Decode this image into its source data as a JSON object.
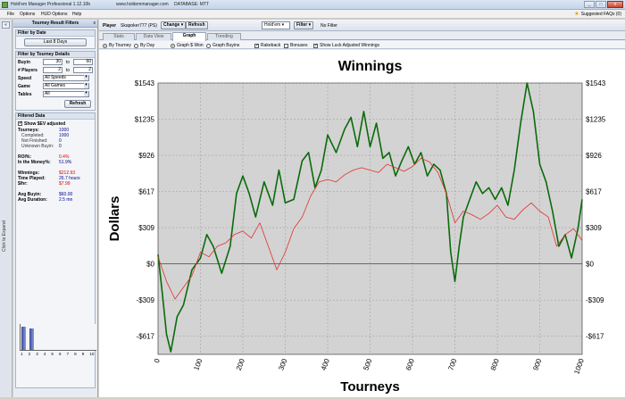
{
  "window": {
    "title": "Hold'em Manager Professional 1.12.10b",
    "url": "www.holdemmanager.com",
    "database": "DATABASE: MTT",
    "buttons": [
      "_",
      "□",
      "x"
    ]
  },
  "menu": {
    "items": [
      "File",
      "Options",
      "HUD Options",
      "Help"
    ],
    "suggested": "Suggested FAQs (0)"
  },
  "leftstrip": {
    "pin": "«",
    "label": "Click to Expand"
  },
  "filters": {
    "header": "Tourney Result Filters",
    "close": "x",
    "by_date": {
      "title": "Filter by Date",
      "button": "Last 8 Days"
    },
    "details": {
      "title": "Filter by Tourney Details",
      "buyin": {
        "label": "Buyin",
        "from": "30",
        "to_label": "to",
        "to": "60"
      },
      "players": {
        "label": "# Players",
        "from": "2",
        "to_label": "to",
        "to": "2"
      },
      "speed": {
        "label": "Speed",
        "value": "All Speeds"
      },
      "game": {
        "label": "Game",
        "value": "All Games"
      },
      "tables": {
        "label": "Tables",
        "value": "All"
      },
      "refresh": "Refresh"
    },
    "filtered": {
      "title": "Filtered Data",
      "show_ev": "Show $EV adjusted",
      "stats": [
        {
          "k": "Tourneys:",
          "v": "1000",
          "sub": false,
          "red": false
        },
        {
          "k": "Completed:",
          "v": "1000",
          "sub": true,
          "red": false
        },
        {
          "k": "Not Finished:",
          "v": "0",
          "sub": true,
          "red": false
        },
        {
          "k": "Unknown Buyin:",
          "v": "0",
          "sub": true,
          "red": false
        },
        {
          "k": "",
          "v": "",
          "sub": false,
          "red": false
        },
        {
          "k": "ROI%:",
          "v": "0.4%",
          "sub": false,
          "red": true
        },
        {
          "k": "In the Money%:",
          "v": "51.9%",
          "sub": false,
          "red": false
        },
        {
          "k": "",
          "v": "",
          "sub": false,
          "red": false
        },
        {
          "k": "Winnings:",
          "v": "$212.93",
          "sub": false,
          "red": true
        },
        {
          "k": "Time Played:",
          "v": "26.7 hours",
          "sub": false,
          "red": false
        },
        {
          "k": "$/hr:",
          "v": "$7.99",
          "sub": false,
          "red": true
        },
        {
          "k": "",
          "v": "",
          "sub": false,
          "red": false
        },
        {
          "k": "Avg Buyin:",
          "v": "$60.00",
          "sub": false,
          "red": false
        },
        {
          "k": "Avg Duration:",
          "v": "2.5 mn",
          "sub": false,
          "red": false
        }
      ],
      "mini_chart": {
        "labels": [
          "1",
          "2",
          "3",
          "4",
          "5",
          "6",
          "7",
          "8",
          "9",
          "10"
        ],
        "values": [
          0.86,
          0.8,
          0,
          0,
          0,
          0,
          0,
          0,
          0,
          0
        ]
      }
    }
  },
  "toolbar": {
    "player_label": "Player",
    "player_name": "Skapoker777 (PS)",
    "change": "Change",
    "refresh": "Refresh",
    "game_select": "Hold'em",
    "filter": "Filter",
    "no_filter": "No Filter"
  },
  "tabs": [
    "Stats",
    "Data View",
    "Graph",
    "Trending"
  ],
  "active_tab": "Graph",
  "options": {
    "by_tourney": "By Tourney",
    "by_day": "By Day",
    "graph_won": "Graph $ Won",
    "graph_buyins": "Graph Buyins",
    "rakeback": "Rakeback",
    "bonuses": "Bonuses",
    "luck_adjusted": "Show Luck Adjusted Winnings"
  },
  "colors": {
    "won": "#0a6b0a",
    "luck": "#e03030",
    "plot_bg": "#d3d3d3"
  },
  "chart_data": {
    "type": "line",
    "title": "Winnings",
    "xlabel": "Tourneys",
    "ylabel": "Dollars",
    "xlim": [
      0,
      1000
    ],
    "ylim": [
      -772,
      1543
    ],
    "x_ticks": [
      0,
      100,
      200,
      300,
      400,
      500,
      600,
      700,
      800,
      900,
      1000
    ],
    "y_ticks": [
      {
        "v": 1543,
        "label": "$1543"
      },
      {
        "v": 1235,
        "label": "$1235"
      },
      {
        "v": 926,
        "label": "$926"
      },
      {
        "v": 617,
        "label": "$617"
      },
      {
        "v": 309,
        "label": "$309"
      },
      {
        "v": 0,
        "label": "$0"
      },
      {
        "v": -309,
        "label": "-$309"
      },
      {
        "v": -617,
        "label": "-$617"
      }
    ],
    "grid": true,
    "series": [
      {
        "name": "",
        "color": "#0a6b0a",
        "x": [
          0,
          10,
          20,
          30,
          45,
          60,
          80,
          100,
          115,
          130,
          150,
          170,
          185,
          200,
          215,
          230,
          250,
          270,
          285,
          300,
          320,
          340,
          355,
          370,
          385,
          400,
          420,
          440,
          455,
          470,
          485,
          500,
          515,
          530,
          545,
          560,
          575,
          590,
          605,
          620,
          635,
          650,
          665,
          680,
          690,
          700,
          710,
          720,
          735,
          750,
          765,
          780,
          795,
          810,
          825,
          840,
          855,
          870,
          885,
          900,
          915,
          930,
          945,
          960,
          975,
          990,
          1000
        ],
        "y": [
          80,
          -250,
          -600,
          -750,
          -450,
          -350,
          -50,
          50,
          250,
          150,
          -80,
          150,
          600,
          750,
          600,
          400,
          700,
          500,
          800,
          520,
          550,
          880,
          950,
          650,
          800,
          1100,
          950,
          1150,
          1250,
          1000,
          1300,
          1000,
          1200,
          900,
          950,
          750,
          880,
          1000,
          850,
          950,
          750,
          850,
          800,
          600,
          100,
          -150,
          150,
          400,
          550,
          700,
          600,
          650,
          550,
          650,
          500,
          800,
          1200,
          1543,
          1300,
          850,
          700,
          450,
          150,
          250,
          50,
          300,
          550
        ]
      },
      {
        "name": "",
        "color": "#e03030",
        "x": [
          0,
          20,
          40,
          60,
          80,
          100,
          120,
          140,
          160,
          180,
          200,
          220,
          240,
          260,
          280,
          300,
          320,
          340,
          360,
          380,
          400,
          420,
          440,
          460,
          480,
          500,
          520,
          540,
          560,
          580,
          600,
          620,
          640,
          660,
          680,
          700,
          720,
          740,
          760,
          780,
          800,
          820,
          840,
          860,
          880,
          900,
          920,
          940,
          960,
          980,
          1000
        ],
        "y": [
          60,
          -150,
          -300,
          -200,
          -100,
          100,
          60,
          150,
          180,
          250,
          280,
          220,
          350,
          150,
          -50,
          100,
          300,
          400,
          580,
          700,
          720,
          700,
          760,
          800,
          820,
          800,
          780,
          850,
          820,
          790,
          830,
          900,
          870,
          780,
          600,
          350,
          450,
          420,
          380,
          430,
          500,
          400,
          380,
          460,
          520,
          450,
          400,
          150,
          250,
          300,
          200
        ]
      }
    ]
  }
}
